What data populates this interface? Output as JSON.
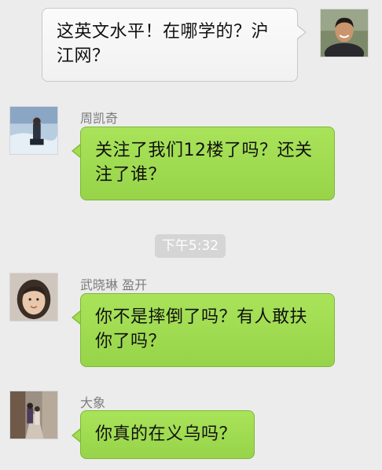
{
  "messages": [
    {
      "direction": "outgoing",
      "sender": "",
      "text": "这英文水平！在哪学的？沪江网？",
      "avatar": "man-smiling-avatar"
    },
    {
      "direction": "incoming",
      "sender": "周凯奇",
      "text": "关注了我们12楼了吗？还关注了谁？",
      "avatar": "snow-scene-avatar"
    },
    {
      "direction": "incoming",
      "sender": "武晓琳 盈开",
      "text": "你不是摔倒了吗？有人敢扶你了吗？",
      "avatar": "girl-portrait-avatar"
    },
    {
      "direction": "incoming",
      "sender": "大象",
      "text": "你真的在义乌吗？",
      "avatar": "street-photo-avatar"
    }
  ],
  "timestamp": "下午5:32",
  "colors": {
    "background": "#ececec",
    "outgoing_bubble": "#f7f7f7",
    "incoming_bubble": "#a2dd52",
    "sender_name": "#7d7d7d",
    "timestamp_bg": "#d5d5d5"
  }
}
